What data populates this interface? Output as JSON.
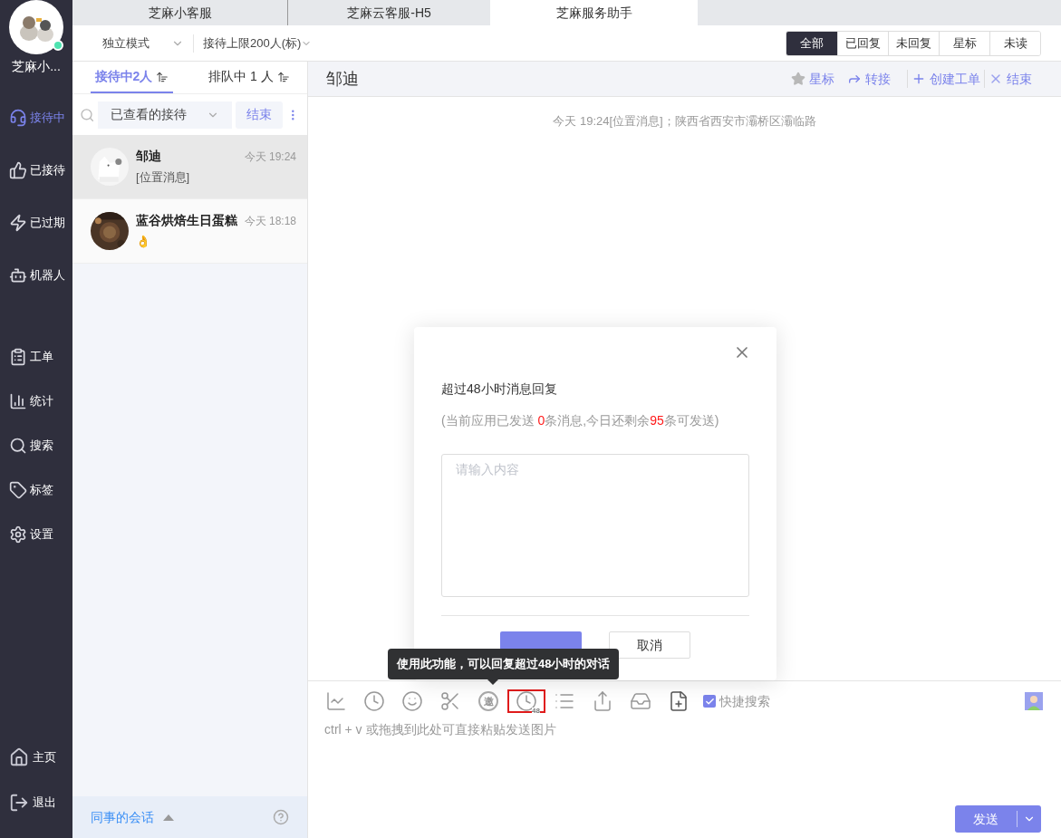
{
  "app_tabs": [
    {
      "label": "芝麻小客服",
      "selected": false
    },
    {
      "label": "芝麻云客服-H5",
      "selected": false
    },
    {
      "label": "芝麻服务助手",
      "selected": true
    }
  ],
  "sidebar": {
    "user_name": "芝麻小...",
    "online": true,
    "nav": [
      {
        "label": "接待中",
        "selected": true
      },
      {
        "label": "已接待",
        "selected": false
      },
      {
        "label": "已过期",
        "selected": false
      },
      {
        "label": "机器人",
        "selected": false
      },
      {
        "label": "工单",
        "selected": false
      },
      {
        "label": "统计",
        "selected": false
      },
      {
        "label": "搜索",
        "selected": false
      },
      {
        "label": "标签",
        "selected": false
      },
      {
        "label": "设置",
        "selected": false
      }
    ],
    "bottom": [
      {
        "label": "主页"
      },
      {
        "label": "退出"
      }
    ]
  },
  "toolbar": {
    "mode": "独立模式",
    "limit": "接待上限200人(标)",
    "filters": [
      {
        "label": "全部",
        "selected": true
      },
      {
        "label": "已回复",
        "selected": false
      },
      {
        "label": "未回复",
        "selected": false
      },
      {
        "label": "星标",
        "selected": false
      },
      {
        "label": "未读",
        "selected": false
      }
    ]
  },
  "queue_tabs": [
    {
      "label": "接待中2人",
      "selected": true
    },
    {
      "label": "排队中 1 人",
      "selected": false
    }
  ],
  "list_filter": {
    "value": "已查看的接待",
    "button": "结束"
  },
  "conversations": [
    {
      "name": "邹迪",
      "time": "今天 19:24",
      "preview": "[位置消息]",
      "selected": true
    },
    {
      "name": "蓝谷烘焙生日蛋糕",
      "time": "今天 18:18",
      "preview": "👌",
      "selected": false
    }
  ],
  "colleague_footer": {
    "label": "同事的会话"
  },
  "chat": {
    "title": "邹迪",
    "actions": [
      {
        "label": "星标"
      },
      {
        "label": "转接"
      },
      {
        "label": "创建工单"
      },
      {
        "label": "结束"
      }
    ],
    "system_message": "今天 19:24[位置消息]；陕西省西安市灞桥区灞临路"
  },
  "modal": {
    "title": "超过48小时消息回复",
    "note_parts": [
      {
        "text": "(当前应用已发送 ",
        "highlight": false
      },
      {
        "text": "0",
        "highlight": true
      },
      {
        "text": "条消息,今日还剩余",
        "highlight": false
      },
      {
        "text": "95",
        "highlight": true
      },
      {
        "text": "条可发送)",
        "highlight": false
      }
    ],
    "placeholder": "请输入内容",
    "cancel": "取消"
  },
  "tooltip": "使用此功能，可以回复超过48小时的对话",
  "composer": {
    "tools": [
      {
        "kind": "chart",
        "selected": false
      },
      {
        "kind": "clock",
        "selected": false
      },
      {
        "kind": "emoji",
        "selected": false
      },
      {
        "kind": "scissors",
        "selected": false
      },
      {
        "kind": "invite",
        "text": "邀",
        "selected": false
      },
      {
        "kind": "clock48",
        "text": "48",
        "selected": true
      },
      {
        "kind": "list",
        "selected": false
      },
      {
        "kind": "share",
        "selected": false
      },
      {
        "kind": "inbox",
        "selected": false
      },
      {
        "kind": "note",
        "selected": false
      }
    ],
    "quick_search": {
      "label": "快捷搜索",
      "checked": true
    },
    "placeholder": "ctrl + v 或拖拽到此处可直接粘贴发送图片",
    "send": "发送"
  }
}
